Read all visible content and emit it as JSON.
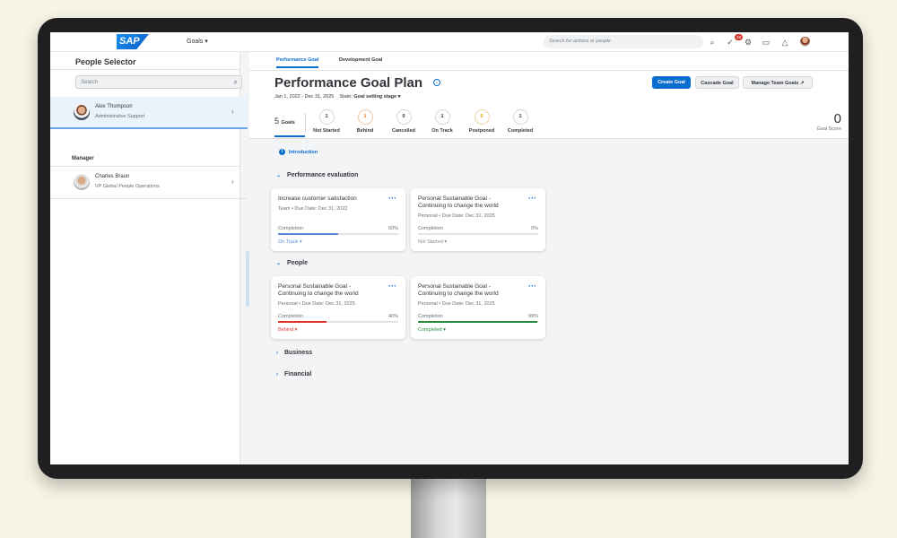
{
  "shell": {
    "logo": "SAP",
    "menu_label": "Goals ▾",
    "search_placeholder": "Search for actions or people",
    "notification_count": "48"
  },
  "people_selector": {
    "title": "People Selector",
    "search_placeholder": "Search",
    "selected_person": {
      "name": "Alex Thompson",
      "role": "Administrative Support"
    },
    "manager_label": "Manager",
    "manager": {
      "name": "Charles Braun",
      "role": "VP Global People Operations"
    }
  },
  "tabs": [
    "Performance Goal",
    "Development Goal"
  ],
  "header": {
    "title": "Performance Goal Plan",
    "date_range": "Jan 1, 2022 - Dec 31, 2025",
    "state_label": "State:",
    "state_value": "Goal setting stage ▾",
    "buttons": {
      "create": "Create Goal",
      "cascade": "Cascade Goal",
      "manage": "Manage Team Goals ↗"
    }
  },
  "summary": {
    "goals_count": "5",
    "goals_label": "Goals",
    "statuses": [
      {
        "count": "1",
        "label": "Not Started"
      },
      {
        "count": "1",
        "label": "Behind"
      },
      {
        "count": "0",
        "label": "Cancelled"
      },
      {
        "count": "1",
        "label": "On Track"
      },
      {
        "count": "0",
        "label": "Postponed"
      },
      {
        "count": "1",
        "label": "Completed"
      }
    ],
    "score_value": "0",
    "score_label": "Goal Score"
  },
  "intro_link": "Introduction",
  "sections": [
    {
      "title": "Performance evaluation",
      "expanded": true
    },
    {
      "title": "People",
      "expanded": true
    },
    {
      "title": "Business",
      "expanded": false
    },
    {
      "title": "Financial",
      "expanded": false
    }
  ],
  "cards": [
    {
      "title": "Increase customer satisfaction",
      "meta": "Team • Due Date: Dec 31, 2022",
      "completion_label": "Completion",
      "percent": "50%",
      "progress": 0.5,
      "status": "On Track ▾",
      "color": "#5b8bd6"
    },
    {
      "title": "Personal Sustainable Goal - Continuing to change the world",
      "meta": "Personal • Due Date: Dec 31, 2025",
      "completion_label": "Completion",
      "percent": "0%",
      "progress": 0,
      "status": "Not Started ▾",
      "color": "#8a8d90"
    },
    {
      "title": "Personal Sustainable Goal - Continuing to change the world",
      "meta": "Personal • Due Date: Dec 31, 2025",
      "completion_label": "Completion",
      "percent": "40%",
      "progress": 0.4,
      "status": "Behind ▾",
      "color": "#e0342f"
    },
    {
      "title": "Personal Sustainable Goal - Continuing to change the world",
      "meta": "Personal • Due Date: Dec 31, 2025",
      "completion_label": "Completion",
      "percent": "99%",
      "progress": 0.99,
      "status": "Completed ▾",
      "color": "#2b8a3e"
    }
  ]
}
